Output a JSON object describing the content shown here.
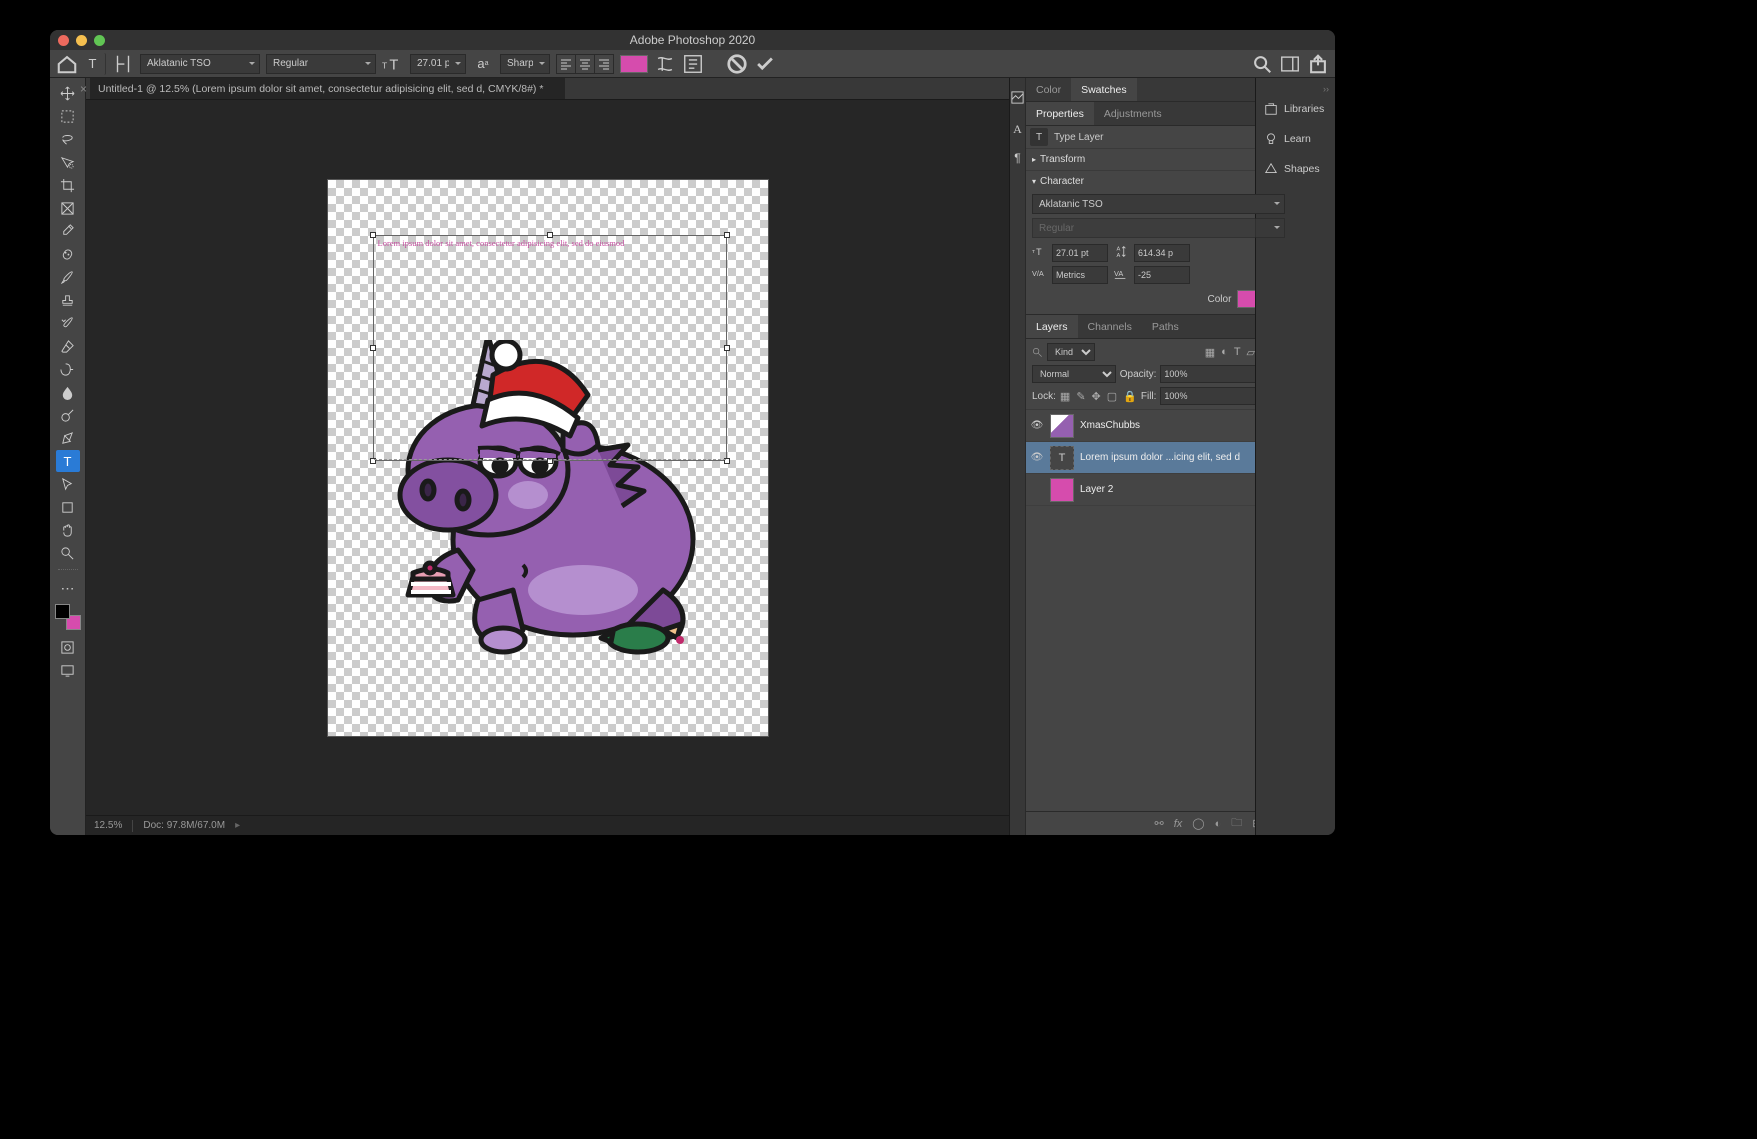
{
  "app_title": "Adobe Photoshop 2020",
  "document_tab": "Untitled-1 @ 12.5% (Lorem ipsum dolor sit amet, consectetur adipisicing elit, sed d, CMYK/8#) *",
  "options_bar": {
    "font_family": "Aklatanic TSO",
    "font_style": "Regular",
    "font_size": "27.01 pt",
    "aa": "Sharp",
    "color": "#d64cad"
  },
  "canvas": {
    "text_content": "Lorem ipsum dolor sit amet, consectetur adipisicing elit, sed do eiusmod"
  },
  "status": {
    "zoom": "12.5%",
    "doc_info": "Doc: 97.8M/67.0M"
  },
  "panels": {
    "color_tab": "Color",
    "swatches_tab": "Swatches",
    "properties_tab": "Properties",
    "adjustments_tab": "Adjustments",
    "type_layer": "Type Layer",
    "transform": "Transform",
    "character": "Character",
    "char_font": "Aklatanic TSO",
    "char_style": "Regular",
    "char_size": "27.01 pt",
    "char_leading": "614.34 p",
    "char_kerning": "Metrics",
    "char_tracking": "-25",
    "char_color_label": "Color",
    "char_color": "#d64cad",
    "libraries": "Libraries",
    "learn": "Learn",
    "shapes": "Shapes"
  },
  "layers": {
    "tab_layers": "Layers",
    "tab_channels": "Channels",
    "tab_paths": "Paths",
    "kind": "Kind",
    "blend": "Normal",
    "opacity_label": "Opacity:",
    "opacity": "100%",
    "lock_label": "Lock:",
    "fill_label": "Fill:",
    "fill": "100%",
    "items": [
      {
        "name": "XmasChubbs",
        "visible": true,
        "thumb": "img"
      },
      {
        "name": "Lorem ipsum dolor ...icing elit, sed d",
        "visible": true,
        "thumb": "T",
        "selected": true
      },
      {
        "name": "Layer 2",
        "visible": false,
        "thumb": "color"
      }
    ]
  }
}
